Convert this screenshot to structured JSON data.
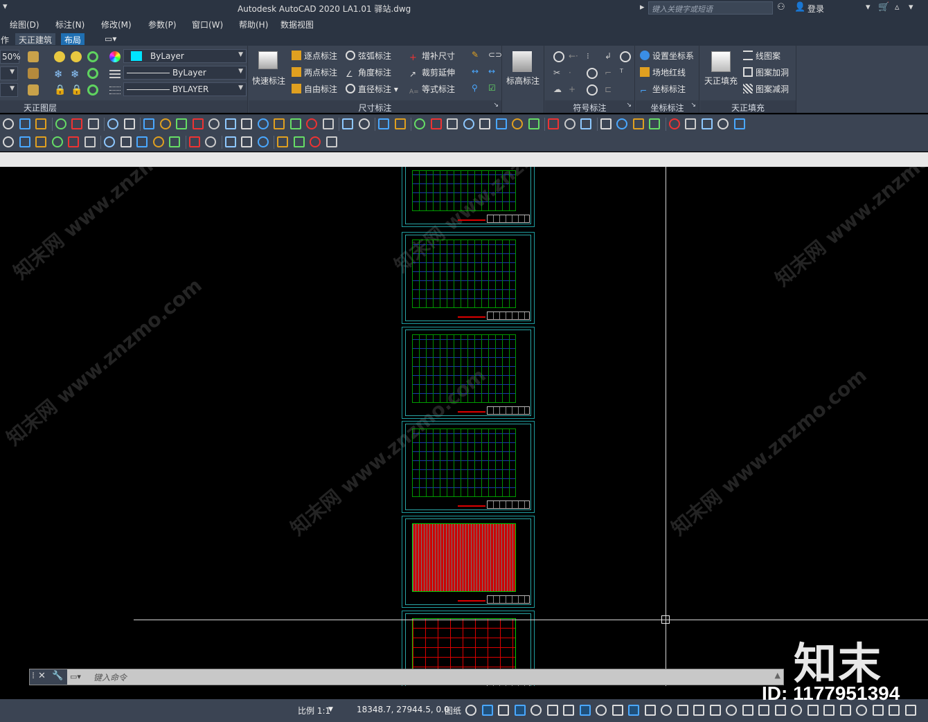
{
  "titlebar": {
    "title": "Autodesk AutoCAD 2020    LA1.01 驿站.dwg",
    "search_placeholder": "键入关键字或短语",
    "login": "登录"
  },
  "menu": {
    "items": [
      "绘图(D)",
      "标注(N)",
      "修改(M)",
      "参数(P)",
      "窗口(W)",
      "帮助(H)",
      "数据视图"
    ]
  },
  "ribbon_tabs": {
    "cut": "作",
    "tianzheng": "天正建筑",
    "layout": "布局"
  },
  "ribbon": {
    "zoom_pct": "50%",
    "color_dd": "ByLayer",
    "linetype_dd": "ByLayer",
    "lineweight_dd": "BYLAYER",
    "panel_layer": "天正图层",
    "quick_dim": "快速标注",
    "dims": [
      "逐点标注",
      "弦弧标注",
      "增补尺寸",
      "两点标注",
      "角度标注",
      "裁剪延伸",
      "自由标注",
      "直径标注",
      "等式标注"
    ],
    "panel_dim": "尺寸标注",
    "elev_dim": "标高标注",
    "panel_symbol": "符号标注",
    "coord": [
      "设置坐标系",
      "场地红线",
      "坐标标注"
    ],
    "panel_coord": "坐标标注",
    "fill_big": "天正填充",
    "fill": [
      "线图案",
      "图案加洞",
      "图案减洞"
    ],
    "panel_fill": "天正填充"
  },
  "cmdline": {
    "placeholder": "键入命令"
  },
  "status": {
    "scale": "比例 1:1",
    "coords": "18348.7, 27944.5, 0.0",
    "paper": "图纸"
  },
  "watermark": {
    "brand": "知末",
    "id": "ID: 1177951394",
    "site": "知末网 www.znzmo.com"
  },
  "colors": {
    "ui_dark": "#2b3442",
    "ribbon": "#3b4453",
    "accent": "#1f6fb2",
    "sheet_border": "#1e9ea0",
    "drawing_green": "#00e000",
    "drawing_red": "#e00000"
  }
}
